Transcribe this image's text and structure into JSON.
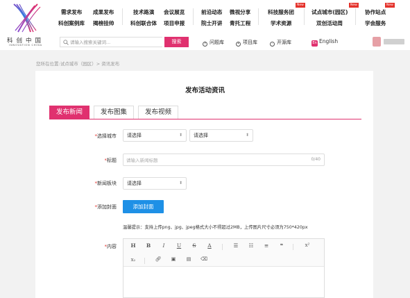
{
  "header": {
    "logo": {
      "cn": "科创中国",
      "en": "INNOVATION CHINA"
    },
    "nav": {
      "col1": [
        "需求发布",
        "科创案例库"
      ],
      "col2": [
        "成果发布",
        "揭榜挂帅"
      ],
      "col3": [
        "技术路演",
        "科创联合体"
      ],
      "col4": [
        "会议展览",
        "项目申报"
      ],
      "col5": [
        "前沿动态",
        "院士开讲"
      ],
      "col6": [
        "微视分享",
        "青托工程"
      ],
      "col7": [
        "科技服务团",
        "学术资源"
      ],
      "col8": [
        "试点城市(园区)",
        "双创活动周"
      ],
      "col9": [
        "协作站点",
        "学会服务"
      ],
      "new_badge": "New"
    },
    "search": {
      "placeholder": "请输入搜索关键词...",
      "button": "搜索"
    },
    "quick_links": [
      "问题库",
      "项目库",
      "开源库"
    ],
    "language": "English",
    "language_icon": "En"
  },
  "breadcrumb": "您所在位置:试点城市（园区）> 资讯发布",
  "page_title": "发布活动资讯",
  "tabs": [
    "发布新闻",
    "发布图集",
    "发布视频"
  ],
  "form": {
    "city_label": "选择城市",
    "city_select_1": "请选择",
    "city_select_2": "请选择",
    "title_label": "标题",
    "title_placeholder": "请输入新闻标题",
    "title_counter": "0/40",
    "section_label": "新闻板块",
    "section_select": "请选择",
    "cover_label": "添加封面",
    "cover_button": "添加封面",
    "cover_tip": "温馨提示：支持上传png、jpg、jpeg格式大小不得超过2MB，上传图片尺寸必须为750*420px",
    "content_label": "内容",
    "required_mark": "*"
  },
  "editor_toolbar": {
    "bold": "H",
    "b": "B",
    "italic": "I",
    "underline": "U",
    "strike": "S",
    "color": "A",
    "sup": "x²",
    "sub": "x₂"
  },
  "colors": {
    "brand": "#e0316f",
    "upload_blue": "#1e90e6",
    "badge_red": "#e4322b"
  }
}
